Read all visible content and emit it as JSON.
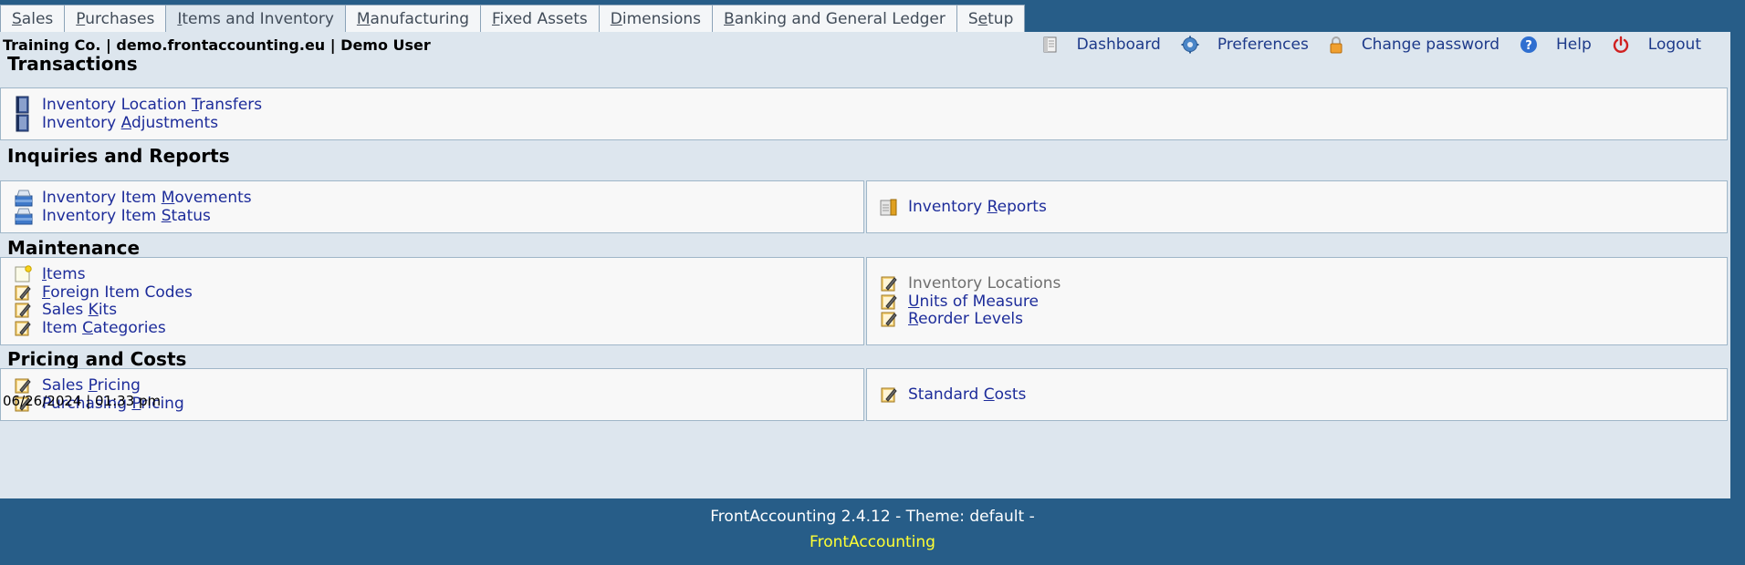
{
  "tabs": [
    {
      "pre": "",
      "key": "S",
      "post": "ales",
      "active": false
    },
    {
      "pre": "",
      "key": "P",
      "post": "urchases",
      "active": false
    },
    {
      "pre": "",
      "key": "I",
      "post": "tems and Inventory",
      "active": true
    },
    {
      "pre": "",
      "key": "M",
      "post": "anufacturing",
      "active": false
    },
    {
      "pre": "",
      "key": "F",
      "post": "ixed Assets",
      "active": false
    },
    {
      "pre": "",
      "key": "D",
      "post": "imensions",
      "active": false
    },
    {
      "pre": "",
      "key": "B",
      "post": "anking and General Ledger",
      "active": false
    },
    {
      "pre": "S",
      "key": "e",
      "post": "tup",
      "active": false
    }
  ],
  "header": {
    "company": "Training Co. | demo.frontaccounting.eu | Demo User",
    "links": [
      {
        "label": "Dashboard",
        "icon": "dashboard-icon"
      },
      {
        "label": "Preferences",
        "icon": "gear-icon"
      },
      {
        "label": "Change password",
        "icon": "lock-icon"
      },
      {
        "label": "Help",
        "icon": "help-icon"
      },
      {
        "label": "Logout",
        "icon": "power-icon"
      }
    ]
  },
  "sections": {
    "transactions": {
      "title": "Transactions",
      "left": [
        {
          "pre": "Inventory Location ",
          "key": "T",
          "post": "ransfers",
          "icon": "transaction-icon",
          "disabled": false
        },
        {
          "pre": "Inventory ",
          "key": "A",
          "post": "djustments",
          "icon": "transaction-icon",
          "disabled": false
        }
      ]
    },
    "inquiries": {
      "title": "Inquiries and Reports",
      "left": [
        {
          "pre": "Inventory Item ",
          "key": "M",
          "post": "ovements",
          "icon": "inquiry-icon",
          "disabled": false
        },
        {
          "pre": "Inventory Item ",
          "key": "S",
          "post": "tatus",
          "icon": "inquiry-icon",
          "disabled": false
        }
      ],
      "right": [
        {
          "pre": "Inventory ",
          "key": "R",
          "post": "eports",
          "icon": "report-icon",
          "disabled": false
        }
      ]
    },
    "maintenance": {
      "title": "Maintenance",
      "left": [
        {
          "pre": "",
          "key": "I",
          "post": "tems",
          "icon": "new-item-icon",
          "disabled": false
        },
        {
          "pre": "",
          "key": "F",
          "post": "oreign Item Codes",
          "icon": "edit-icon",
          "disabled": false
        },
        {
          "pre": "Sales ",
          "key": "K",
          "post": "its",
          "icon": "edit-icon",
          "disabled": false
        },
        {
          "pre": "Item ",
          "key": "C",
          "post": "ategories",
          "icon": "edit-icon",
          "disabled": false
        }
      ],
      "right": [
        {
          "pre": "Inventory Locations",
          "key": "",
          "post": "",
          "icon": "edit-icon",
          "disabled": true
        },
        {
          "pre": "",
          "key": "U",
          "post": "nits of Measure",
          "icon": "edit-icon",
          "disabled": false
        },
        {
          "pre": "",
          "key": "R",
          "post": "eorder Levels",
          "icon": "edit-icon",
          "disabled": false
        }
      ]
    },
    "pricing": {
      "title": "Pricing and Costs",
      "left": [
        {
          "pre": "Sales ",
          "key": "P",
          "post": "ricing",
          "icon": "edit-icon",
          "disabled": false
        },
        {
          "pre": "Purchasing ",
          "key": "P",
          "post": "ricing",
          "icon": "edit-icon",
          "disabled": false
        }
      ],
      "right": [
        {
          "pre": "Standard ",
          "key": "C",
          "post": "osts",
          "icon": "edit-icon",
          "disabled": false
        }
      ]
    }
  },
  "datetime": "06/26/2024 | 01:33 pm",
  "footer": {
    "version": "FrontAccounting 2.4.12 - Theme: default -",
    "link": "FrontAccounting"
  },
  "colors": {
    "background": "#275d88",
    "panel": "#dde6ee",
    "link": "#1d2c9a",
    "footer_link": "#ffff33"
  }
}
